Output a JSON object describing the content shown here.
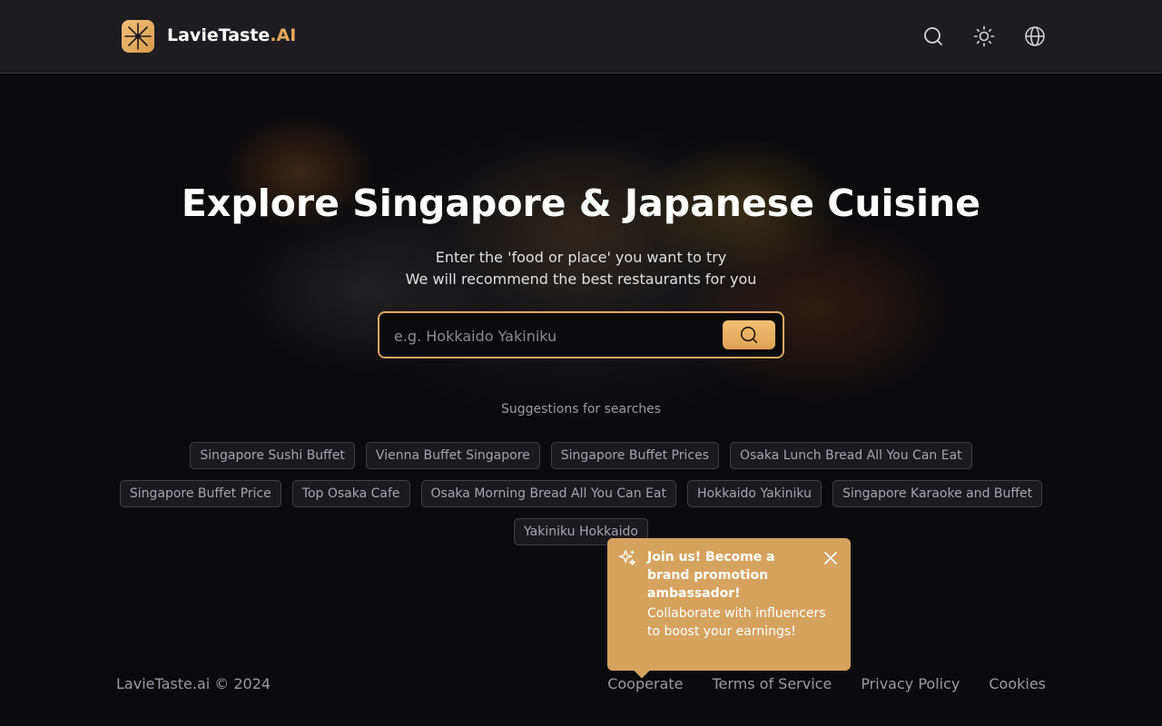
{
  "header": {
    "brand_name": "LavieTaste",
    "brand_suffix": ".AI",
    "icons": [
      "logo-icon",
      "search-icon",
      "sun-icon",
      "globe-icon"
    ]
  },
  "hero": {
    "title": "Explore Singapore & Japanese Cuisine",
    "subtitle_line1": "Enter the 'food or place' you want to try",
    "subtitle_line2": "We will recommend the best restaurants for you"
  },
  "search": {
    "placeholder": "e.g. Hokkaido Yakiniku",
    "value": ""
  },
  "suggestions": {
    "title": "Suggestions for searches",
    "items": [
      "Singapore Sushi Buffet",
      "Vienna Buffet Singapore",
      "Singapore Buffet Prices",
      "Osaka Lunch Bread All You Can Eat",
      "Singapore Buffet Price",
      "Top Osaka Cafe",
      "Osaka Morning Bread All You Can Eat",
      "Hokkaido Yakiniku",
      "Singapore Karaoke and Buffet",
      "Yakiniku Hokkaido"
    ]
  },
  "popup": {
    "title": "Join us! Become a brand promotion ambassador!",
    "body": "Collaborate with influencers to boost your earnings!"
  },
  "footer": {
    "copyright": "LavieTaste.ai © 2024",
    "links": [
      "Cooperate",
      "Terms of Service",
      "Privacy Policy",
      "Cookies"
    ]
  },
  "colors": {
    "accent": "#e0a860",
    "popup_bg": "#d6a35f",
    "header_bg": "#1c1c21",
    "page_bg": "#0b0b0e"
  }
}
